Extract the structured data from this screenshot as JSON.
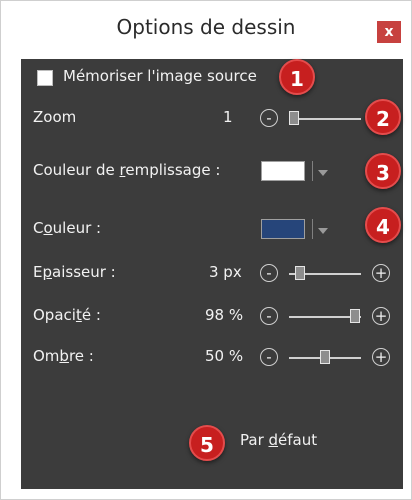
{
  "window": {
    "title": "Options de dessin",
    "close_label": "x"
  },
  "panel": {
    "memorize_checkbox_label": "Mémoriser l'image source",
    "zoom": {
      "label": "Zoom",
      "value": "1",
      "slider_value_pct": 0
    },
    "fill_color": {
      "label_before": "Couleur de ",
      "label_underlined": "r",
      "label_after": "emplissage :",
      "swatch_hex": "#ffffff"
    },
    "color": {
      "label_before": "C",
      "label_underlined": "o",
      "label_after": "uleur :",
      "swatch_hex": "#26457a"
    },
    "thickness": {
      "label_before": "E",
      "label_underlined": "p",
      "label_after": "aisseur :",
      "value": "3 px",
      "slider_value_pct": 10
    },
    "opacity": {
      "label_before": "Opaci",
      "label_underlined": "t",
      "label_after": "é :",
      "value": "98 %",
      "slider_value_pct": 98
    },
    "shadow": {
      "label_before": "Om",
      "label_underlined": "b",
      "label_after": "re :",
      "value": "50 %",
      "slider_value_pct": 50
    },
    "default_button": {
      "label_before": "Par ",
      "label_underlined": "d",
      "label_after": "éfaut"
    },
    "minus_symbol": "-",
    "plus_symbol": "+"
  },
  "callouts": [
    "1",
    "2",
    "3",
    "4",
    "5"
  ],
  "colors": {
    "panel_bg": "#3c3c3c",
    "badge_red": "#c71f1f",
    "close_red": "#c7413f"
  }
}
